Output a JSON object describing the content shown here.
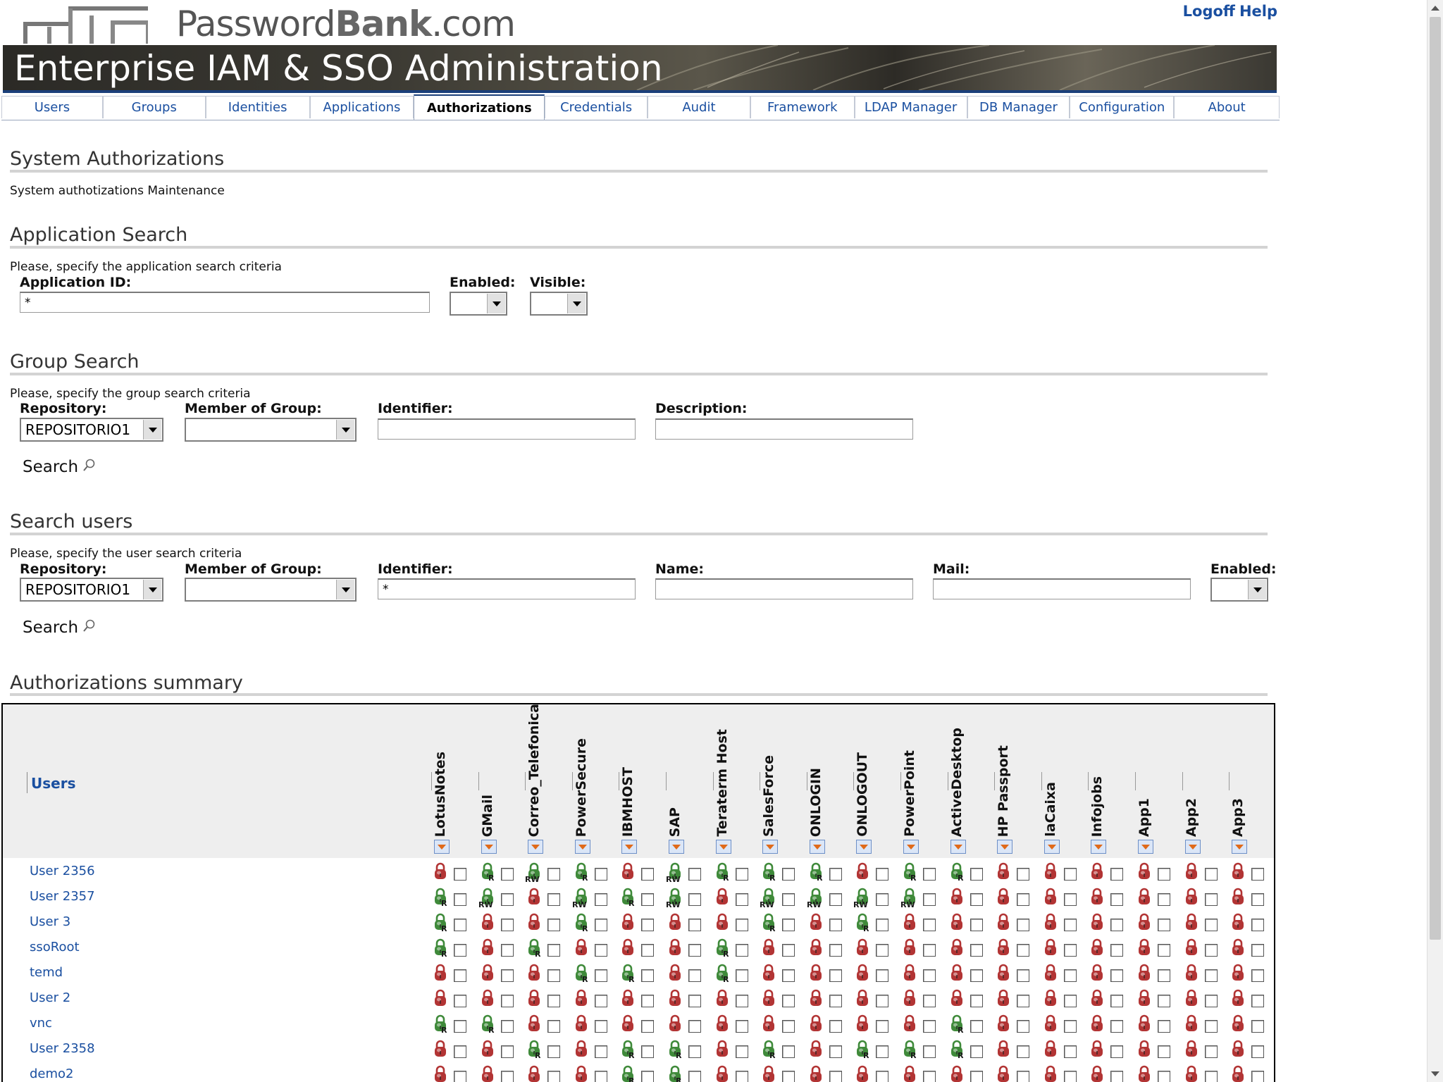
{
  "header": {
    "logo_text_light": "Password",
    "logo_text_bold": "Bank",
    "logo_text_tail": ".com",
    "links": [
      "Logoff",
      "Help"
    ],
    "banner_title": "Enterprise IAM & SSO Administration"
  },
  "tabs": [
    {
      "label": "Users"
    },
    {
      "label": "Groups"
    },
    {
      "label": "Identities"
    },
    {
      "label": "Applications"
    },
    {
      "label": "Authorizations",
      "active": true
    },
    {
      "label": "Credentials"
    },
    {
      "label": "Audit"
    },
    {
      "label": "Framework"
    },
    {
      "label": "LDAP Manager"
    },
    {
      "label": "DB Manager"
    },
    {
      "label": "Configuration"
    },
    {
      "label": "About"
    }
  ],
  "system": {
    "title": "System Authorizations",
    "desc": "System authotizations Maintenance"
  },
  "app_search": {
    "title": "Application Search",
    "desc": "Please, specify the application search criteria",
    "app_id_label": "Application ID:",
    "app_id_value": "*",
    "enabled_label": "Enabled:",
    "enabled_value": "",
    "visible_label": "Visible:",
    "visible_value": ""
  },
  "group_search": {
    "title": "Group Search",
    "desc": "Please, specify the group search criteria",
    "repository_label": "Repository:",
    "repository_value": "REPOSITORIO1",
    "member_label": "Member of Group:",
    "member_value": "",
    "identifier_label": "Identifier:",
    "identifier_value": "",
    "description_label": "Description:",
    "description_value": "",
    "search_label": "Search"
  },
  "user_search": {
    "title": "Search users",
    "desc": "Please, specify the user search criteria",
    "repository_label": "Repository:",
    "repository_value": "REPOSITORIO1",
    "member_label": "Member of Group:",
    "member_value": "",
    "identifier_label": "Identifier:",
    "identifier_value": "*",
    "name_label": "Name:",
    "name_value": "",
    "mail_label": "Mail:",
    "mail_value": "",
    "enabled_label": "Enabled:",
    "enabled_value": "",
    "search_label": "Search"
  },
  "summary": {
    "title": "Authorizations summary",
    "users_header": "Users",
    "apps": [
      "LotusNotes",
      "GMail",
      "Correo_Telefonica",
      "PowerSecure",
      "IBMHOST",
      "SAP",
      "Teraterm Host",
      "SalesForce",
      "ONLOGIN",
      "ONLOGOUT",
      "PowerPoint",
      "ActiveDesktop",
      "HP Passport",
      "laCaixa",
      "Infojobs",
      "App1",
      "App2",
      "App3"
    ],
    "colors": {
      "granted": "#3f8a3a",
      "denied": "#b23434"
    },
    "rows": [
      {
        "user": "User 2356",
        "perms": [
          "",
          "R",
          "RW",
          "R",
          "",
          "RW",
          "R",
          "R",
          "R",
          "",
          "R",
          "R",
          "",
          "",
          "",
          "",
          "",
          ""
        ]
      },
      {
        "user": "User 2357",
        "perms": [
          "R",
          "RW",
          "",
          "RW",
          "R",
          "RW",
          "",
          "RW",
          "RW",
          "RW",
          "RW",
          "",
          "",
          "",
          "",
          "",
          "",
          ""
        ]
      },
      {
        "user": "User 3",
        "perms": [
          "R",
          "",
          "",
          "R",
          "",
          "",
          "",
          "R",
          "",
          "R",
          "",
          "",
          "",
          "",
          "",
          "",
          "",
          ""
        ]
      },
      {
        "user": "ssoRoot",
        "perms": [
          "R",
          "",
          "R",
          "",
          "",
          "",
          "R",
          "",
          "",
          "",
          "",
          "",
          "",
          "",
          "",
          "",
          "",
          ""
        ]
      },
      {
        "user": "temd",
        "perms": [
          "",
          "",
          "",
          "R",
          "R",
          "",
          "R",
          "",
          "",
          "",
          "",
          "",
          "",
          "",
          "",
          "",
          "",
          ""
        ]
      },
      {
        "user": "User 2",
        "perms": [
          "",
          "",
          "",
          "",
          "",
          "",
          "",
          "",
          "",
          "",
          "",
          "",
          "",
          "",
          "",
          "",
          "",
          ""
        ]
      },
      {
        "user": "vnc",
        "perms": [
          "R",
          "R",
          "",
          "",
          "",
          "",
          "",
          "",
          "",
          "",
          "",
          "R",
          "",
          "",
          "",
          "",
          "",
          ""
        ]
      },
      {
        "user": "User 2358",
        "perms": [
          "",
          "",
          "R",
          "",
          "R",
          "R",
          "",
          "R",
          "",
          "R",
          "R",
          "R",
          "",
          "",
          "",
          "",
          "",
          ""
        ]
      },
      {
        "user": "demo2",
        "perms": [
          "",
          "",
          "",
          "",
          "R",
          "R",
          "",
          "",
          "",
          "",
          "",
          "",
          "",
          "",
          "",
          "",
          "",
          ""
        ]
      }
    ]
  }
}
